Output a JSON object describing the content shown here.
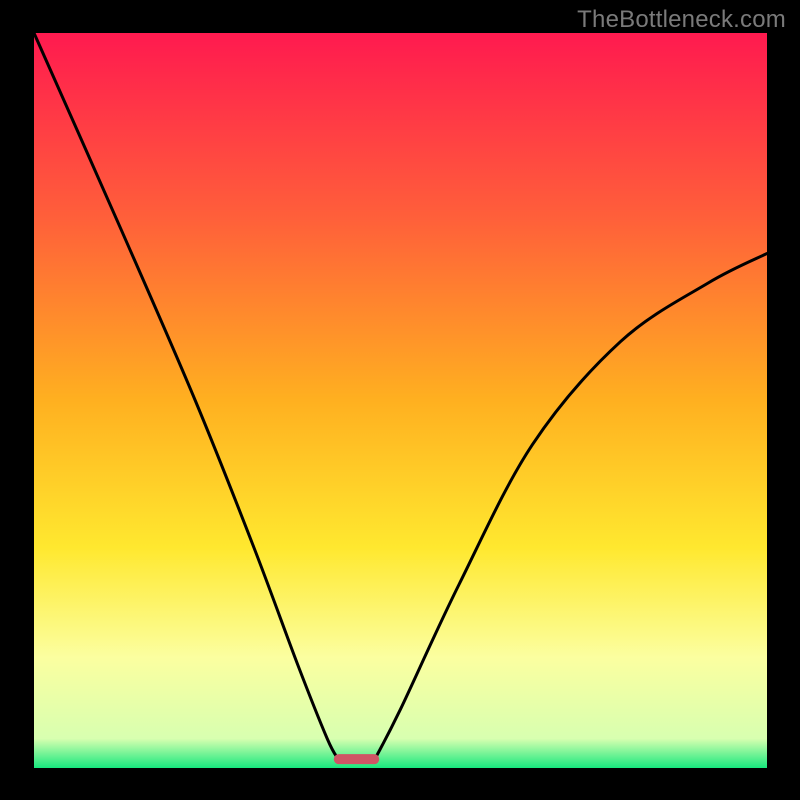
{
  "watermark": "TheBottleneck.com",
  "chart_data": {
    "type": "line",
    "title": "",
    "xlabel": "",
    "ylabel": "",
    "xlim": [
      0,
      100
    ],
    "ylim": [
      0,
      100
    ],
    "background_gradient": {
      "stops": [
        {
          "y": 0,
          "color": "#ff1a4f"
        },
        {
          "y": 25,
          "color": "#ff5f3a"
        },
        {
          "y": 50,
          "color": "#ffb020"
        },
        {
          "y": 70,
          "color": "#ffe82f"
        },
        {
          "y": 85,
          "color": "#fbffa0"
        },
        {
          "y": 96,
          "color": "#d8ffb0"
        },
        {
          "y": 100,
          "color": "#17e87e"
        }
      ]
    },
    "curve": {
      "type": "v-curve",
      "description": "Two monotone arcs meeting near the bottom; estimated (x,y) anchor points in chart coords (0..100)",
      "left_branch": [
        {
          "x": 0,
          "y": 100
        },
        {
          "x": 12,
          "y": 73
        },
        {
          "x": 22,
          "y": 50
        },
        {
          "x": 30,
          "y": 30
        },
        {
          "x": 36,
          "y": 14
        },
        {
          "x": 40,
          "y": 4
        },
        {
          "x": 41.5,
          "y": 1.2
        }
      ],
      "right_branch": [
        {
          "x": 46.5,
          "y": 1.2
        },
        {
          "x": 50,
          "y": 8
        },
        {
          "x": 58,
          "y": 25
        },
        {
          "x": 68,
          "y": 44
        },
        {
          "x": 80,
          "y": 58
        },
        {
          "x": 92,
          "y": 66
        },
        {
          "x": 100,
          "y": 70
        }
      ]
    },
    "marker": {
      "description": "Small rounded bar at the valley bottom",
      "x_center": 44,
      "width": 6.2,
      "y": 1.2,
      "color": "#cf5565"
    }
  }
}
